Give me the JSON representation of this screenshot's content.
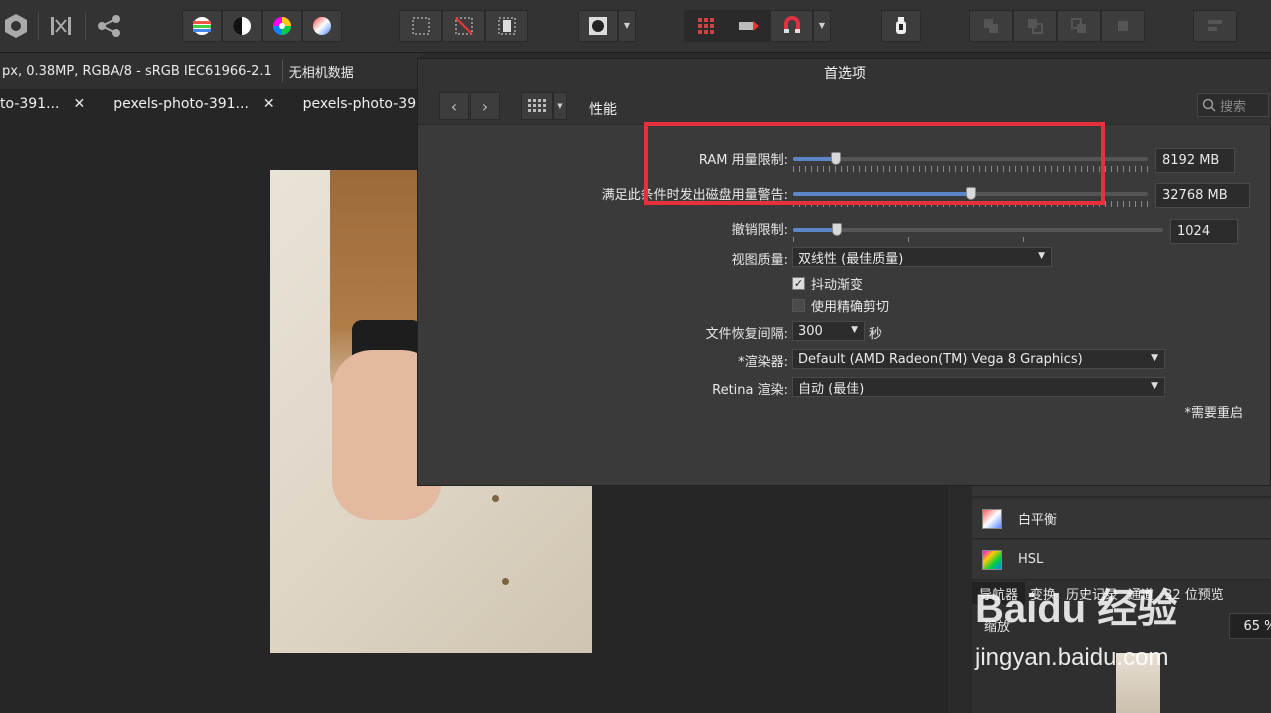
{
  "context_bar": {
    "info": "px, 0.38MP, RGBA/8 - sRGB IEC61966-2.1",
    "camera": "无相机数据"
  },
  "tabs": [
    {
      "label": "to-391..."
    },
    {
      "label": "pexels-photo-391..."
    },
    {
      "label": "pexels-photo-391..."
    }
  ],
  "close_glyph": "✕",
  "dialog": {
    "title": "首选项",
    "section": "性能",
    "search_placeholder": "搜索",
    "ram_label": "RAM 用量限制:",
    "ram_value": "8192 MB",
    "ram_fraction": 0.12,
    "disk_label": "满足此条件时发出磁盘用量警告:",
    "disk_value": "32768 MB",
    "disk_fraction": 0.5,
    "undo_label": "撤销限制:",
    "undo_value": "1024",
    "undo_fraction": 0.12,
    "view_quality_label": "视图质量:",
    "view_quality_value": "双线性 (最佳质量)",
    "dither_label": "抖动渐变",
    "precise_clip_label": "使用精确剪切",
    "recovery_label": "文件恢复间隔:",
    "recovery_value": "300",
    "recovery_unit": "秒",
    "renderer_label": "*渲染器:",
    "renderer_value": "Default (AMD Radeon(TM) Vega 8 Graphics)",
    "retina_label": "Retina 渲染:",
    "retina_value": "自动 (最佳)",
    "restart_note": "*需要重启"
  },
  "right_panel": {
    "adjustments": [
      {
        "label": "白平衡"
      },
      {
        "label": "HSL"
      }
    ],
    "tabs": [
      "导航器",
      "变换",
      "历史记录",
      "通道",
      "32 位预览"
    ],
    "zoom_label": "缩放",
    "zoom_value": "65 %"
  },
  "watermark": {
    "brand": "Baidu 经验",
    "url": "jingyan.baidu.com"
  },
  "colors": {
    "accent": "#5b86c8",
    "highlight": "#e8303a"
  }
}
